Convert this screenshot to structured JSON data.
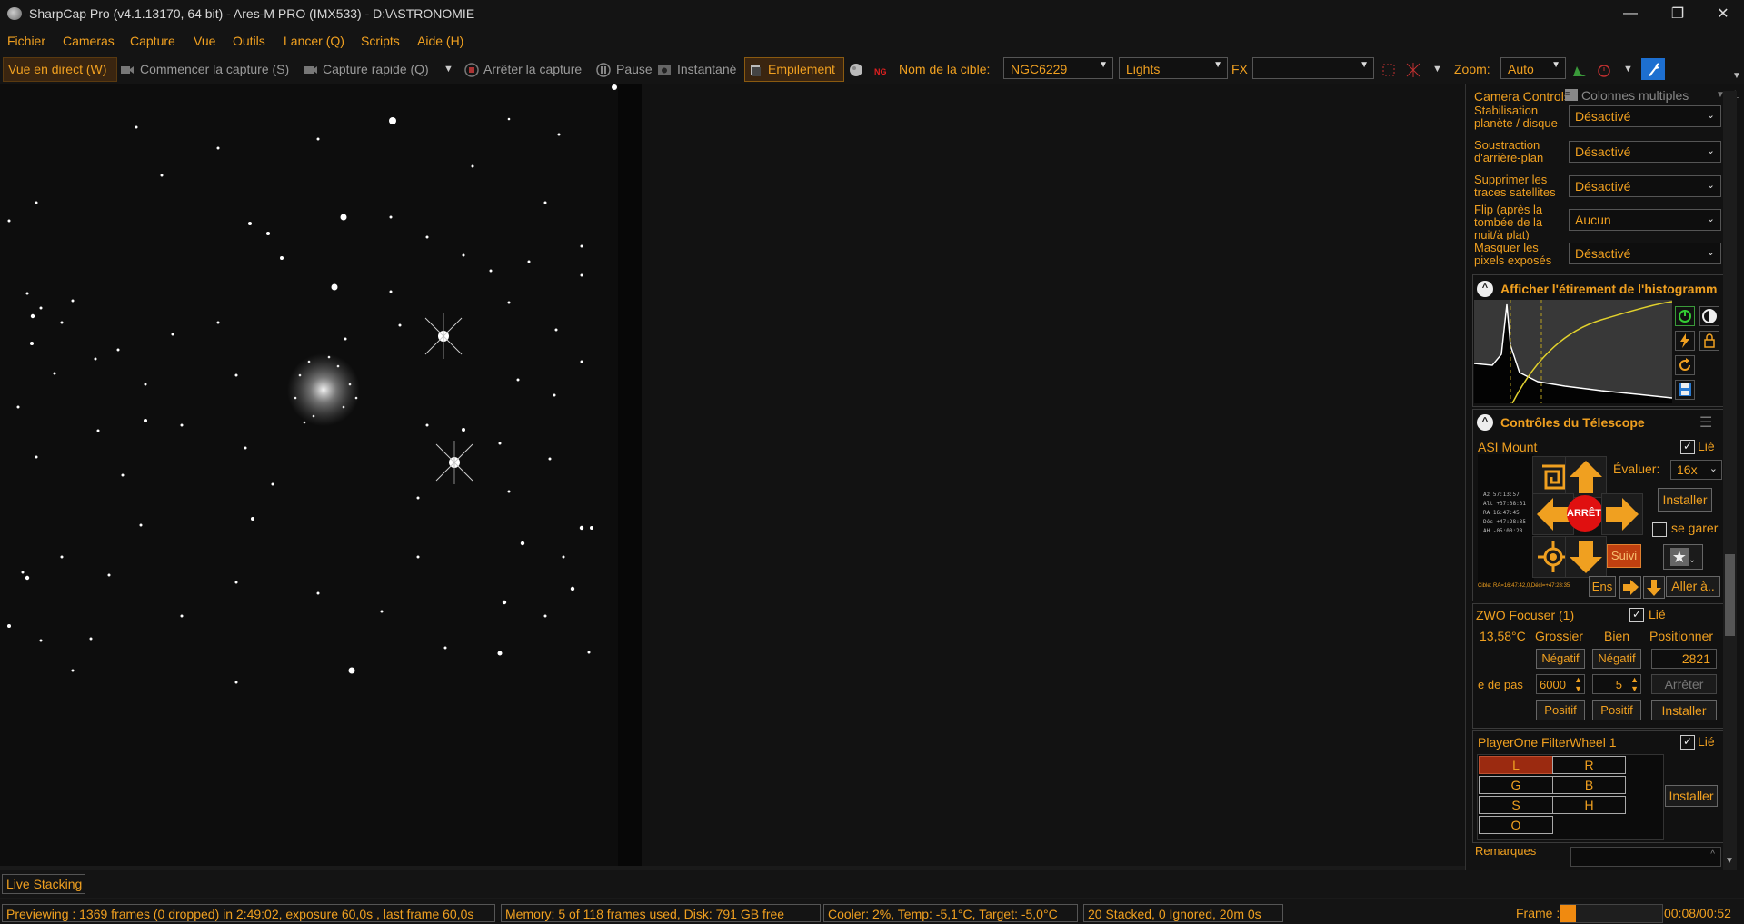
{
  "app": {
    "title": "SharpCap Pro (v4.1.13170, 64 bit) - Ares-M PRO (IMX533) - D:\\ASTRONOMIE",
    "controls": {
      "minimize": "—",
      "restore": "❐",
      "close": "✕"
    }
  },
  "menu": [
    "Fichier",
    "Cameras",
    "Capture",
    "Vue",
    "Outils",
    "Lancer (Q)",
    "Scripts",
    "Aide (H)"
  ],
  "toolbar": {
    "live": "Vue en direct (W)",
    "start_capture": "Commencer la capture (S)",
    "quick_capture": "Capture rapide (Q)",
    "stop_capture": "Arrêter la capture",
    "pause": "Pause",
    "snapshot": "Instantané",
    "stacking": "Empilement",
    "target_label": "Nom de la cible:",
    "target_value": "NGC6229",
    "frame_type": "Lights",
    "fx_label": "FX",
    "fx_value": "",
    "zoom_label": "Zoom:",
    "zoom_value": "Auto"
  },
  "panel": {
    "tab_camera": "Camera Controls",
    "tab_columns": "Colonnes multiples",
    "settings": [
      {
        "label": "Stabilisation planète / disque",
        "value": "Désactivé"
      },
      {
        "label": "Soustraction d'arrière-plan",
        "value": "Désactivé"
      },
      {
        "label": "Supprimer les traces satellites",
        "value": "Désactivé"
      },
      {
        "label": "Flip (après la tombée de la nuit/à plat)",
        "value": "Aucun"
      },
      {
        "label": "Masquer les pixels exposés",
        "value": "Désactivé"
      }
    ],
    "histogram_title": "Afficher l'étirement de l'histogramm",
    "telescope_title": "Contrôles du Télescope",
    "mount_name": "ASI Mount",
    "linked": "Lié",
    "rate_label": "Évaluer:",
    "rate_value": "16x",
    "install": "Installer",
    "park": "se garer",
    "stop": "ARRÊTE",
    "track": "Suivi",
    "sync": "Ens",
    "goto": "Aller à..",
    "mount_readout": [
      "Az    57:13:57",
      "Alt  +37:38:31",
      "RA    16:47:45",
      "Déc +47:28:35",
      "AH   -05:00:28"
    ],
    "target_line": "Cible: RA=16:47:42,0,Décl=+47:28:35",
    "focuser_name": "ZWO Focuser (1)",
    "focuser_temp": "13,58°C",
    "coarse": "Grossier",
    "fine": "Bien",
    "position": "Positionner",
    "negative": "Négatif",
    "positive": "Positif",
    "step_label": "e de pas",
    "coarse_step": "6000",
    "fine_step": "5",
    "focuser_position": "2821",
    "focuser_stop": "Arrêter",
    "filterwheel_name": "PlayerOne FilterWheel 1",
    "filters": [
      "L",
      "R",
      "G",
      "B",
      "S",
      "H",
      "O"
    ],
    "filter_selected": "L",
    "notes_label": "Remarques"
  },
  "stacking_tab": "Live Stacking",
  "status": {
    "preview": "Previewing : 1369 frames (0 dropped) in 2:49:02, exposure 60,0s , last frame 60,0s",
    "memory": "Memory: 5 of 118 frames used, Disk: 791 GB free",
    "cooler": "Cooler: 2%, Temp: -5,1°C, Target: -5,0°C",
    "stacked": "20 Stacked, 0 Ignored, 20m 0s",
    "frame_label": "Frame :",
    "frame_time": "00:08/00:52",
    "frame_progress": 0.1538
  },
  "colors": {
    "accent": "#f0a020",
    "background": "#141414",
    "stop_red": "#e01010",
    "filter_selected": "#9b2a10"
  }
}
